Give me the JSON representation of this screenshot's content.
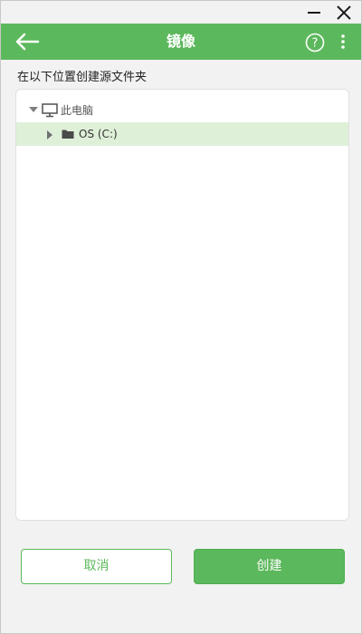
{
  "window": {
    "minimize_icon": "minimize-icon",
    "close_icon": "close-icon"
  },
  "header": {
    "title": "镜像",
    "back_icon": "arrow-left-icon",
    "help_icon": "help-circle-icon",
    "more_icon": "more-vertical-icon",
    "background_color": "#5cb85c"
  },
  "prompt": "在以下位置创建源文件夹",
  "tree": {
    "root": {
      "label": "此电脑",
      "icon": "monitor-icon",
      "expanded": true
    },
    "children": [
      {
        "label": "OS (C:)",
        "icon": "folder-icon",
        "expanded": false,
        "selected": true
      }
    ],
    "selected_color": "#dff0d8"
  },
  "buttons": {
    "cancel_label": "取消",
    "create_label": "创建"
  },
  "colors": {
    "accent": "#5cb85c",
    "background": "#f2f2f2"
  }
}
